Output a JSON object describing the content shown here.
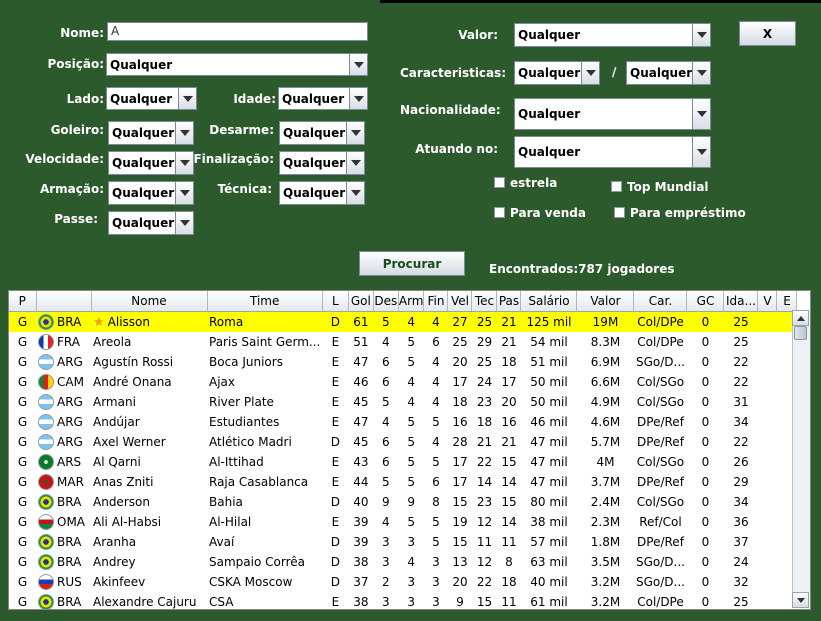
{
  "filters": {
    "nome": {
      "label": "Nome:",
      "value": "A"
    },
    "posicao": {
      "label": "Posição:",
      "value": "Qualquer"
    },
    "lado": {
      "label": "Lado:",
      "value": "Qualquer"
    },
    "idade": {
      "label": "Idade:",
      "value": "Qualquer"
    },
    "goleiro": {
      "label": "Goleiro:",
      "value": "Qualquer"
    },
    "desarme": {
      "label": "Desarme:",
      "value": "Qualquer"
    },
    "velocidade": {
      "label": "Velocidade:",
      "value": "Qualquer"
    },
    "finalizacao": {
      "label": "Finalização:",
      "value": "Qualquer"
    },
    "armacao": {
      "label": "Armação:",
      "value": "Qualquer"
    },
    "tecnica": {
      "label": "Técnica:",
      "value": "Qualquer"
    },
    "passe": {
      "label": "Passe:",
      "value": "Qualquer"
    },
    "valor": {
      "label": "Valor:",
      "value": "Qualquer"
    },
    "caracteristicas": {
      "label": "Caracteristicas:",
      "value1": "Qualquer",
      "separator": "/",
      "value2": "Qualquer"
    },
    "nacionalidade": {
      "label": "Nacionalidade:",
      "value": "Qualquer"
    },
    "atuando": {
      "label": "Atuando no:",
      "value": "Qualquer"
    },
    "checks": {
      "estrela": "estrela",
      "top_mundial": "Top Mundial",
      "para_venda": "Para venda",
      "para_emprestimo": "Para empréstimo"
    },
    "close_label": "X",
    "search_label": "Procurar",
    "found_text": "Encontrados:787 jogadores"
  },
  "table": {
    "headers": [
      "P",
      "",
      "Nome",
      "Time",
      "L",
      "Gol",
      "Des",
      "Arm",
      "Fin",
      "Vel",
      "Tec",
      "Pas",
      "Salário",
      "Valor",
      "Car.",
      "GC",
      "Ida...",
      "V",
      "E"
    ],
    "rows": [
      {
        "p": "G",
        "flag": "BRA",
        "nat": "BRA",
        "star": true,
        "nome": "Alisson",
        "time": "Roma",
        "l": "D",
        "gol": "61",
        "des": "5",
        "arm": "4",
        "fin": "4",
        "vel": "27",
        "tec": "25",
        "pas": "21",
        "sal": "125 mil",
        "valor": "19M",
        "car": "Col/DPe",
        "gc": "0",
        "ida": "25",
        "v": "",
        "e": "",
        "selected": true
      },
      {
        "p": "G",
        "flag": "FRA",
        "nat": "FRA",
        "nome": "Areola",
        "time": "Paris Saint Germ...",
        "l": "E",
        "gol": "51",
        "des": "4",
        "arm": "5",
        "fin": "6",
        "vel": "25",
        "tec": "29",
        "pas": "21",
        "sal": "54 mil",
        "valor": "8.3M",
        "car": "Col/DPe",
        "gc": "0",
        "ida": "25",
        "v": "",
        "e": ""
      },
      {
        "p": "G",
        "flag": "ARG",
        "nat": "ARG",
        "nome": "Agustín Rossi",
        "time": "Boca Juniors",
        "l": "E",
        "gol": "47",
        "des": "6",
        "arm": "5",
        "fin": "4",
        "vel": "20",
        "tec": "25",
        "pas": "18",
        "sal": "51 mil",
        "valor": "6.9M",
        "car": "SGo/D...",
        "gc": "0",
        "ida": "22",
        "v": "",
        "e": ""
      },
      {
        "p": "G",
        "flag": "CAM",
        "nat": "CAM",
        "nome": "André Onana",
        "time": "Ajax",
        "l": "E",
        "gol": "46",
        "des": "6",
        "arm": "4",
        "fin": "4",
        "vel": "17",
        "tec": "24",
        "pas": "17",
        "sal": "50 mil",
        "valor": "6.6M",
        "car": "Col/SGo",
        "gc": "0",
        "ida": "22",
        "v": "",
        "e": ""
      },
      {
        "p": "G",
        "flag": "ARG",
        "nat": "ARG",
        "nome": "Armani",
        "time": "River Plate",
        "l": "E",
        "gol": "45",
        "des": "5",
        "arm": "4",
        "fin": "4",
        "vel": "18",
        "tec": "23",
        "pas": "20",
        "sal": "50 mil",
        "valor": "4.9M",
        "car": "Col/SGo",
        "gc": "0",
        "ida": "31",
        "v": "",
        "e": ""
      },
      {
        "p": "G",
        "flag": "ARG",
        "nat": "ARG",
        "nome": "Andújar",
        "time": "Estudiantes",
        "l": "E",
        "gol": "47",
        "des": "4",
        "arm": "5",
        "fin": "5",
        "vel": "16",
        "tec": "18",
        "pas": "16",
        "sal": "46 mil",
        "valor": "4.6M",
        "car": "DPe/Ref",
        "gc": "0",
        "ida": "34",
        "v": "",
        "e": ""
      },
      {
        "p": "G",
        "flag": "ARG",
        "nat": "ARG",
        "nome": "Axel Werner",
        "time": "Atlético Madri",
        "l": "D",
        "gol": "45",
        "des": "6",
        "arm": "5",
        "fin": "4",
        "vel": "28",
        "tec": "21",
        "pas": "21",
        "sal": "47 mil",
        "valor": "5.7M",
        "car": "DPe/Ref",
        "gc": "0",
        "ida": "22",
        "v": "",
        "e": ""
      },
      {
        "p": "G",
        "flag": "ARS",
        "nat": "ARS",
        "nome": "Al Qarni",
        "time": "Al-Ittihad",
        "l": "E",
        "gol": "43",
        "des": "6",
        "arm": "5",
        "fin": "5",
        "vel": "17",
        "tec": "22",
        "pas": "15",
        "sal": "47 mil",
        "valor": "4M",
        "car": "Col/SGo",
        "gc": "0",
        "ida": "26",
        "v": "",
        "e": ""
      },
      {
        "p": "G",
        "flag": "MAR",
        "nat": "MAR",
        "nome": "Anas Zniti",
        "time": "Raja Casablanca",
        "l": "E",
        "gol": "44",
        "des": "5",
        "arm": "5",
        "fin": "6",
        "vel": "17",
        "tec": "14",
        "pas": "14",
        "sal": "47 mil",
        "valor": "3.7M",
        "car": "DPe/Ref",
        "gc": "0",
        "ida": "29",
        "v": "",
        "e": ""
      },
      {
        "p": "G",
        "flag": "BRA",
        "nat": "BRA",
        "nome": "Anderson",
        "time": "Bahia",
        "l": "D",
        "gol": "40",
        "des": "9",
        "arm": "9",
        "fin": "8",
        "vel": "15",
        "tec": "23",
        "pas": "15",
        "sal": "80 mil",
        "valor": "2.4M",
        "car": "Col/SGo",
        "gc": "0",
        "ida": "34",
        "v": "",
        "e": ""
      },
      {
        "p": "G",
        "flag": "OMA",
        "nat": "OMA",
        "nome": "Ali Al-Habsi",
        "time": "Al-Hilal",
        "l": "E",
        "gol": "39",
        "des": "4",
        "arm": "5",
        "fin": "5",
        "vel": "19",
        "tec": "12",
        "pas": "14",
        "sal": "38 mil",
        "valor": "2.3M",
        "car": "Ref/Col",
        "gc": "0",
        "ida": "36",
        "v": "",
        "e": ""
      },
      {
        "p": "G",
        "flag": "BRA",
        "nat": "BRA",
        "nome": "Aranha",
        "time": "Avaí",
        "l": "D",
        "gol": "39",
        "des": "3",
        "arm": "3",
        "fin": "5",
        "vel": "15",
        "tec": "11",
        "pas": "11",
        "sal": "57 mil",
        "valor": "1.8M",
        "car": "DPe/Ref",
        "gc": "0",
        "ida": "37",
        "v": "",
        "e": ""
      },
      {
        "p": "G",
        "flag": "BRA",
        "nat": "BRA",
        "nome": "Andrey",
        "time": "Sampaio Corrêa",
        "l": "D",
        "gol": "38",
        "des": "3",
        "arm": "4",
        "fin": "3",
        "vel": "13",
        "tec": "12",
        "pas": "8",
        "sal": "63 mil",
        "valor": "3.5M",
        "car": "SGo/D...",
        "gc": "0",
        "ida": "24",
        "v": "",
        "e": ""
      },
      {
        "p": "G",
        "flag": "RUS",
        "nat": "RUS",
        "nome": "Akinfeev",
        "time": "CSKA Moscow",
        "l": "D",
        "gol": "37",
        "des": "2",
        "arm": "3",
        "fin": "3",
        "vel": "20",
        "tec": "22",
        "pas": "18",
        "sal": "40 mil",
        "valor": "3.2M",
        "car": "SGo/D...",
        "gc": "0",
        "ida": "32",
        "v": "",
        "e": ""
      },
      {
        "p": "G",
        "flag": "BRA",
        "nat": "BRA",
        "nome": "Alexandre Cajuru",
        "time": "CSA",
        "l": "E",
        "gol": "38",
        "des": "3",
        "arm": "3",
        "fin": "3",
        "vel": "9",
        "tec": "15",
        "pas": "11",
        "sal": "61 mil",
        "valor": "3.2M",
        "car": "Col/DPe",
        "gc": "0",
        "ida": "25",
        "v": "",
        "e": ""
      }
    ]
  }
}
